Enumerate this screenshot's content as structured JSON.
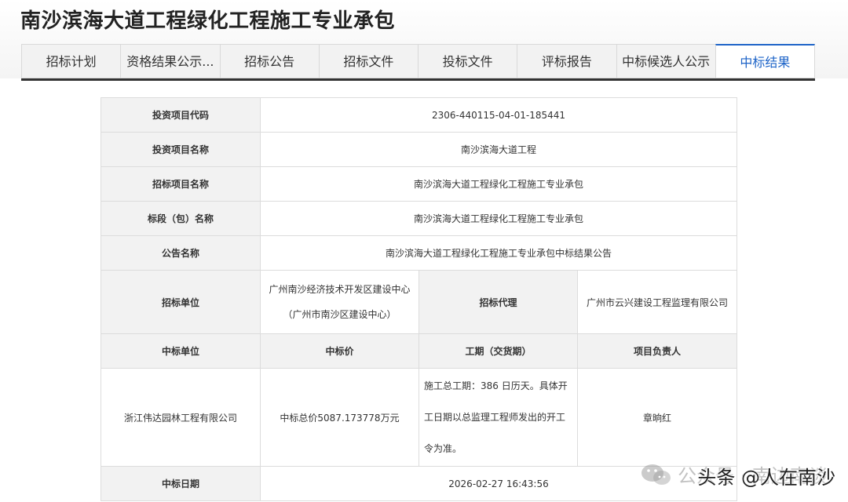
{
  "page": {
    "title": "南沙滨海大道工程绿化工程施工专业承包"
  },
  "tabs": [
    {
      "label": "招标计划",
      "active": false
    },
    {
      "label": "资格结果公示...",
      "active": false
    },
    {
      "label": "招标公告",
      "active": false
    },
    {
      "label": "招标文件",
      "active": false
    },
    {
      "label": "投标文件",
      "active": false
    },
    {
      "label": "评标报告",
      "active": false
    },
    {
      "label": "中标候选人公示",
      "active": false
    },
    {
      "label": "中标结果",
      "active": true
    }
  ],
  "table": {
    "project_code_label": "投资项目代码",
    "project_code": "2306-440115-04-01-185441",
    "project_name_label": "投资项目名称",
    "project_name": "南沙滨海大道工程",
    "tender_project_name_label": "招标项目名称",
    "tender_project_name": "南沙滨海大道工程绿化工程施工专业承包",
    "section_name_label": "标段（包）名称",
    "section_name": "南沙滨海大道工程绿化工程施工专业承包",
    "notice_name_label": "公告名称",
    "notice_name": "南沙滨海大道工程绿化工程施工专业承包中标结果公告",
    "tenderer_label": "招标单位",
    "tenderer_line1": "广州南沙经济技术开发区建设中心",
    "tenderer_line2": "（广州市南沙区建设中心）",
    "agent_label": "招标代理",
    "agent": "广州市云兴建设工程监理有限公司",
    "winner_label": "中标单位",
    "price_label": "中标价",
    "duration_label": "工期（交货期）",
    "manager_label": "项目负责人",
    "winner": "浙江伟达园林工程有限公司",
    "price": "中标总价5087.173778万元",
    "duration": "施工总工期：386 日历天。具体开工日期以总监理工程师发出的开工令为准。",
    "manager": "章晌红",
    "award_date_label": "中标日期",
    "award_date": "2026-02-27 16:43:56"
  },
  "watermark": {
    "text1": "公众号 · 南边南谈",
    "text2": "头条 @人在南沙",
    "icon": "wechat-icon"
  }
}
